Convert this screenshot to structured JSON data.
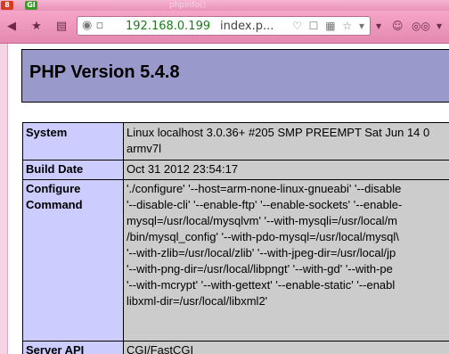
{
  "titlebar": {
    "badge_left": "8",
    "badge_right": "GI",
    "faint_title": "phpinfo()"
  },
  "toolbar": {
    "address_host": "192.168.0.199",
    "address_path": "index.p...",
    "address_tools": "♡ ☐ ▦ ☆ ▾",
    "icons": [
      "back-icon",
      "star-icon",
      "page-icon",
      "globe-icon",
      "heart-icon",
      "table-icon",
      "dropdown-icon",
      "profile-icon",
      "owl-icon"
    ]
  },
  "page": {
    "title": "PHP Version 5.4.8",
    "rows": [
      {
        "key": "System",
        "value_lines": [
          "Linux localhost 3.0.36+ #205 SMP PREEMPT Sat Jun 14 0",
          "armv7l"
        ]
      },
      {
        "key": "Build Date",
        "value_lines": [
          "Oct 31 2012 23:54:17"
        ]
      },
      {
        "key_lines": [
          "Configure",
          "Command"
        ],
        "value_lines": [
          "'./configure' '--host=arm-none-linux-gnueabi' '--disable",
          "'--disable-cli' '--enable-ftp' '--enable-sockets' '--enable-",
          "mysql=/usr/local/mysqlvm' '--with-mysqli=/usr/local/m",
          "/bin/mysql_config' '--with-pdo-mysql=/usr/local/mysql\\",
          "'--with-zlib=/usr/local/zlib' '--with-jpeg-dir=/usr/local/jp",
          "'--with-png-dir=/usr/local/libpngt' '--with-gd' '--with-pe",
          "'--with-mcrypt' '--with-gettext' '--enable-static' '--enabl",
          "libxml-dir=/usr/local/libxml2'"
        ]
      },
      {
        "key": "Server API",
        "value_lines": [
          "CGI/FastCGI"
        ]
      }
    ]
  }
}
